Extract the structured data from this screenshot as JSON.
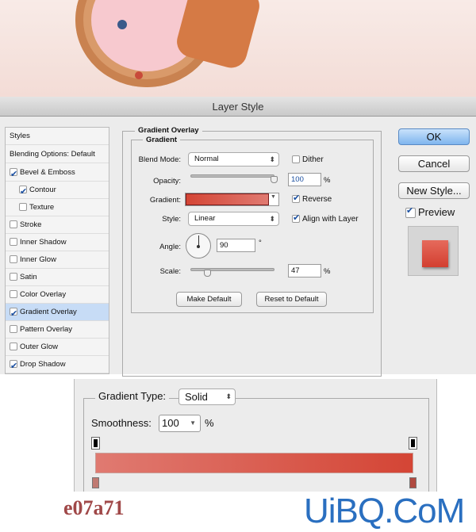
{
  "window": {
    "title": "Layer Style"
  },
  "styles_panel": {
    "header": "Styles",
    "blending": "Blending Options: Default",
    "items": [
      {
        "label": "Bevel & Emboss",
        "checked": true
      },
      {
        "label": "Contour",
        "checked": true,
        "indent": true
      },
      {
        "label": "Texture",
        "checked": false,
        "indent": true
      },
      {
        "label": "Stroke",
        "checked": false
      },
      {
        "label": "Inner Shadow",
        "checked": false
      },
      {
        "label": "Inner Glow",
        "checked": false
      },
      {
        "label": "Satin",
        "checked": false
      },
      {
        "label": "Color Overlay",
        "checked": false
      },
      {
        "label": "Gradient Overlay",
        "checked": true,
        "selected": true
      },
      {
        "label": "Pattern Overlay",
        "checked": false
      },
      {
        "label": "Outer Glow",
        "checked": false
      },
      {
        "label": "Drop Shadow",
        "checked": true
      }
    ]
  },
  "gradient_overlay": {
    "title": "Gradient Overlay",
    "subtitle": "Gradient",
    "blend_mode_label": "Blend Mode:",
    "blend_mode": "Normal",
    "dither_label": "Dither",
    "dither": false,
    "opacity_label": "Opacity:",
    "opacity": "100",
    "opacity_unit": "%",
    "gradient_label": "Gradient:",
    "reverse_label": "Reverse",
    "reverse": true,
    "style_label": "Style:",
    "style": "Linear",
    "align_label": "Align with Layer",
    "align": true,
    "angle_label": "Angle:",
    "angle": "90",
    "angle_unit": "°",
    "scale_label": "Scale:",
    "scale": "47",
    "scale_unit": "%",
    "make_default": "Make Default",
    "reset_default": "Reset to Default"
  },
  "buttons": {
    "ok": "OK",
    "cancel": "Cancel",
    "new_style": "New Style...",
    "preview_label": "Preview",
    "preview": true
  },
  "gradient_editor": {
    "type_label": "Gradient Type:",
    "type": "Solid",
    "smoothness_label": "Smoothness:",
    "smoothness": "100",
    "smoothness_unit": "%"
  },
  "colors": {
    "gradient_start": "#e07a71",
    "gradient_end": "#d44535",
    "accent": "#c7dcf6"
  },
  "caption": "e07a71",
  "watermark": "UiBQ.CoM"
}
